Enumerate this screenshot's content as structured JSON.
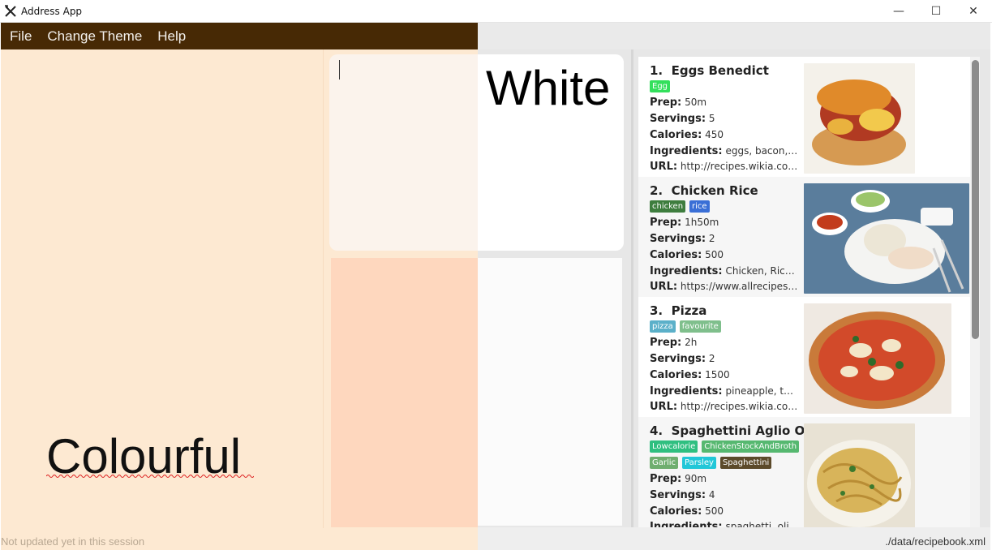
{
  "window": {
    "title": "Address App",
    "minimize": "—",
    "maximize": "☐",
    "close": "✕"
  },
  "menu": {
    "items": [
      "File",
      "Change Theme",
      "Help"
    ]
  },
  "labels": {
    "colourful": "Colourful",
    "white": "White"
  },
  "status": {
    "left": "Not updated yet in this session",
    "right": "./data/recipebook.xml"
  },
  "field_labels": {
    "prep": "Prep:",
    "servings": "Servings:",
    "calories": "Calories:",
    "ingredients": "Ingredients:",
    "url": "URL:"
  },
  "recipes": [
    {
      "index": "1.",
      "name": "Eggs Benedict",
      "tags": [
        {
          "label": "Egg",
          "color": "#33e05c"
        }
      ],
      "prep": "50m",
      "servings": "5",
      "calories": "450",
      "ingredients": "eggs, bacon, tomatoes",
      "url": "http://recipes.wikia.com/wiki/Eggs_Benedict",
      "image": "eggs-benedict-photo"
    },
    {
      "index": "2.",
      "name": "Chicken Rice",
      "tags": [
        {
          "label": "chicken",
          "color": "#3e7d3e"
        },
        {
          "label": "rice",
          "color": "#3a6fd6"
        }
      ],
      "prep": "1h50m",
      "servings": "2",
      "calories": "500",
      "ingredients": "Chicken, Rice, Cucumber",
      "url": "https://www.allrecipes.com/recipe",
      "image": "chicken-rice-photo"
    },
    {
      "index": "3.",
      "name": "Pizza",
      "tags": [
        {
          "label": "pizza",
          "color": "#5bb0c9"
        },
        {
          "label": "favourite",
          "color": "#7fbf8c"
        }
      ],
      "prep": "2h",
      "servings": "2",
      "calories": "1500",
      "ingredients": "pineapple, tomato, cheese",
      "url": "http://recipes.wikia.com/wiki/Pizza",
      "image": "pizza-photo"
    },
    {
      "index": "4.",
      "name": "Spaghettini Aglio Oglio",
      "tags": [
        {
          "label": "Lowcalorie",
          "color": "#2fbf80"
        },
        {
          "label": "ChickenStockAndBroth",
          "color": "#56b870"
        },
        {
          "label": "Garlic",
          "color": "#6fae6f"
        },
        {
          "label": "Parsley",
          "color": "#22c7d8"
        },
        {
          "label": "Spaghettini",
          "color": "#5c4a2a"
        }
      ],
      "prep": "90m",
      "servings": "4",
      "calories": "500",
      "ingredients": "spaghetti, olive oil, garlic",
      "url": "",
      "image": "spaghetti-photo"
    }
  ]
}
